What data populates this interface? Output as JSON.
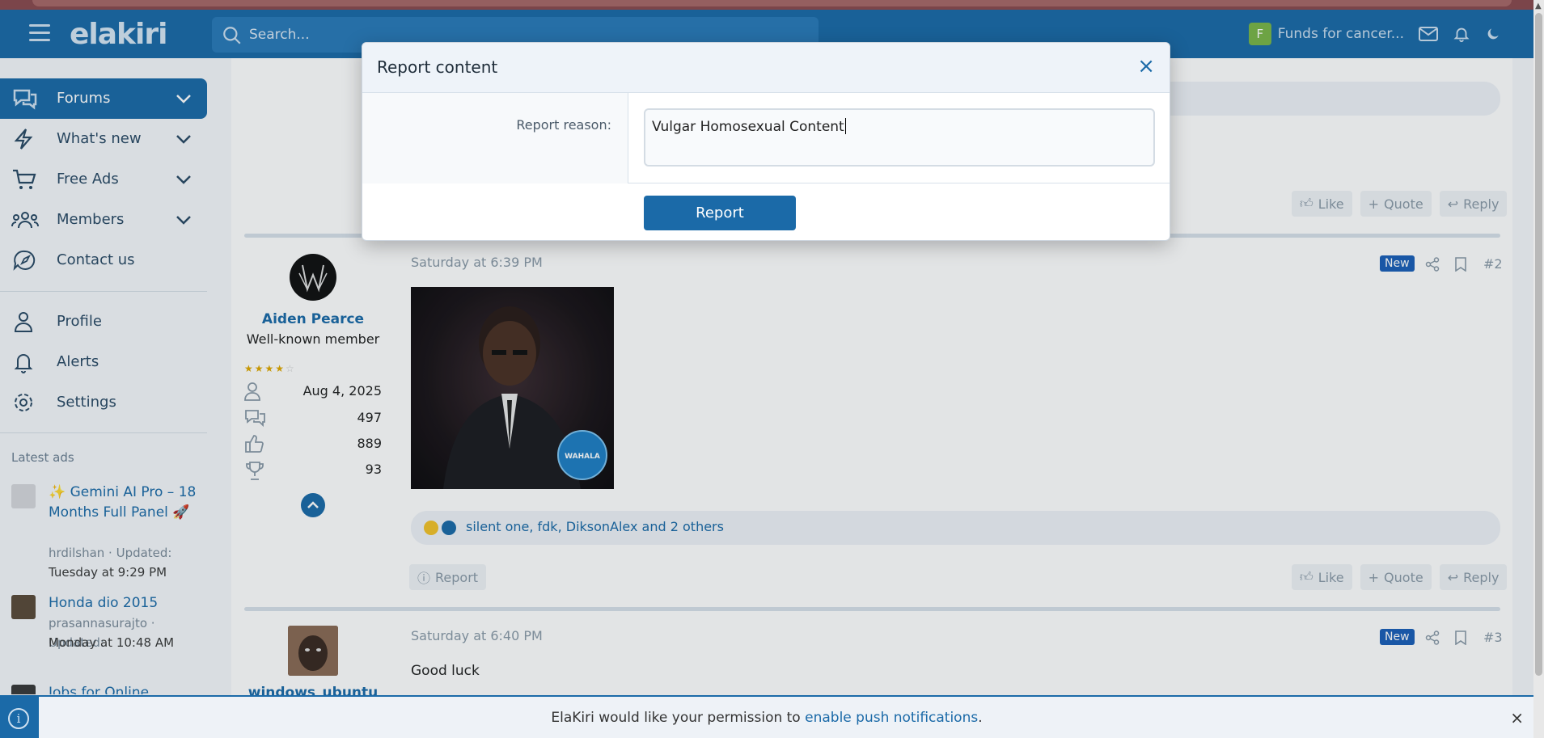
{
  "header": {
    "logo": "elakiri",
    "search_placeholder": "Search...",
    "fund_badge": "F",
    "fund_label": "Funds for cancer..."
  },
  "sidebar": {
    "items": [
      {
        "label": "Forums"
      },
      {
        "label": "What's new"
      },
      {
        "label": "Free Ads"
      },
      {
        "label": "Members"
      },
      {
        "label": "Contact us"
      },
      {
        "label": "Profile"
      },
      {
        "label": "Alerts"
      },
      {
        "label": "Settings"
      }
    ],
    "latest_ads_heading": "Latest ads",
    "ads": [
      {
        "title": "✨ Gemini AI Pro – 18 Months Full Panel 🚀",
        "author": "hrdilshan · Updated:",
        "updated": "Tuesday at 9:29 PM"
      },
      {
        "title": "Honda dio 2015",
        "author": "prasannasurajto · Updated:",
        "updated": "Monday at 10:48 AM"
      },
      {
        "title": "Jobs for Online"
      }
    ]
  },
  "post_actions": {
    "like": "Like",
    "quote": "Quote",
    "reply": "Reply",
    "report": "Report"
  },
  "posts": [
    {
      "date": "Saturday at 6:39 PM",
      "badge": "New",
      "number": "#2",
      "author": "Aiden Pearce",
      "user_title": "Well-known member",
      "rating": 4.5,
      "joined": "Aug 4, 2025",
      "messages": "497",
      "reactions_score": "889",
      "points": "93",
      "reactions_text": "silent one, fdk, DiksonAlex and 2 others",
      "image_watermark": "WAHALA"
    },
    {
      "date": "Saturday at 6:40 PM",
      "badge": "New",
      "number": "#3",
      "author": "windows_ubuntu",
      "text": "Good luck"
    }
  ],
  "modal": {
    "title": "Report content",
    "close": "×",
    "reason_label": "Report reason:",
    "reason_value": "Vulgar Homosexual Content",
    "submit_label": "Report"
  },
  "notification": {
    "prefix": "ElaKiri would like your permission to ",
    "link": "enable push notifications",
    "suffix": ".",
    "info": "i",
    "close": "×"
  },
  "colors": {
    "brand": "#1b6aa8",
    "new_badge": "#1b5fb8",
    "fund_badge": "#7ab648",
    "star": "#e0a800"
  }
}
